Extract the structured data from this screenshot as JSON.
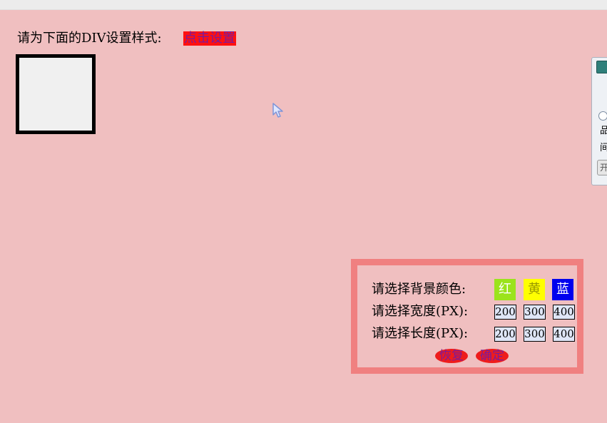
{
  "prompt": {
    "text": "请为下面的DIV设置样式:",
    "link_label": "点击设置"
  },
  "side_widget": {
    "line1": "品",
    "line2": "间",
    "button_label": "开"
  },
  "panel": {
    "bg_label": "请选择背景颜色:",
    "width_label": "请选择宽度(PX):",
    "length_label": "请选择长度(PX):",
    "colors": [
      {
        "label": "红",
        "color": "#9be31c"
      },
      {
        "label": "黄",
        "color": "#ffff00"
      },
      {
        "label": "蓝",
        "color": "#0000ee"
      }
    ],
    "widths": [
      "200",
      "300",
      "400"
    ],
    "lengths": [
      "200",
      "300",
      "400"
    ],
    "reset_label": "恢复",
    "confirm_label": "确定"
  }
}
